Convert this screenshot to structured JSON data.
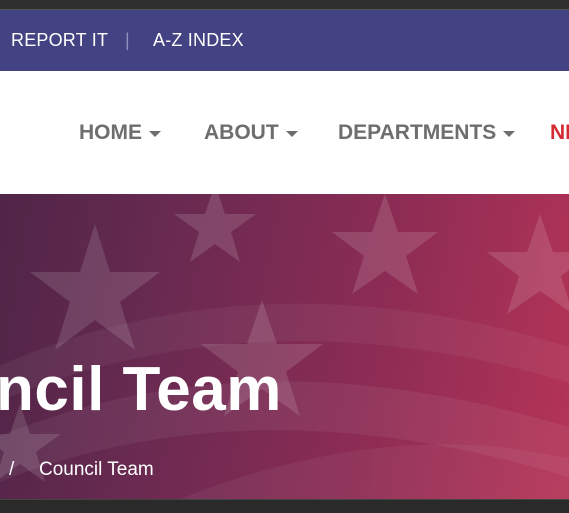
{
  "utility": {
    "report_label": "REPORT IT",
    "divider": "|",
    "az_label": "A-Z INDEX"
  },
  "nav": {
    "home": "HOME",
    "about": "ABOUT",
    "departments": "DEPARTMENTS",
    "news": "NE"
  },
  "hero": {
    "title": "ncil Team",
    "breadcrumb_sep": "/",
    "breadcrumb_current": "Council Team"
  },
  "colors": {
    "utility_bg": "#434282",
    "nav_text": "#6e6e6e",
    "nav_accent": "#d42a34",
    "hero_start": "#4f2547",
    "hero_end": "#b53457"
  },
  "icons": {
    "caret": "chevron-down-icon"
  }
}
